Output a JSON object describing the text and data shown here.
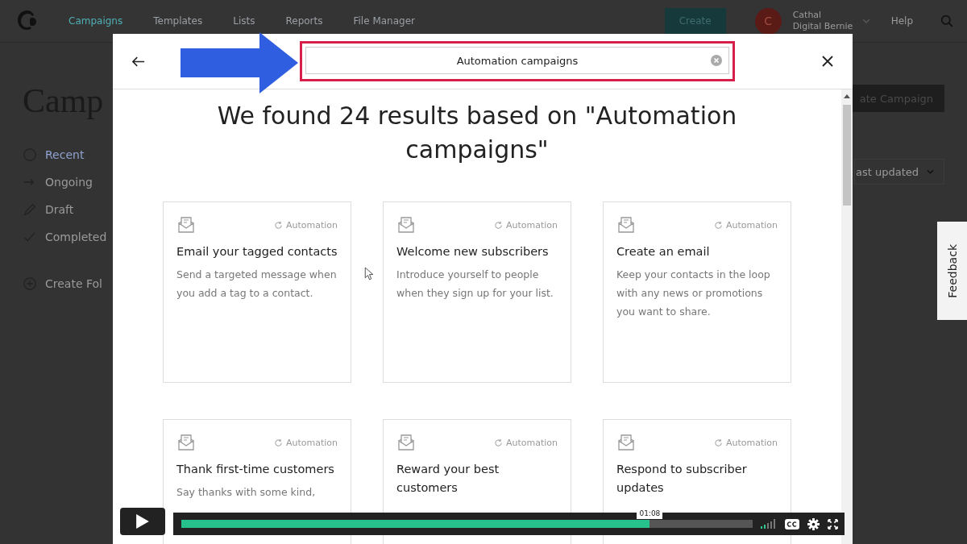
{
  "app_nav": {
    "items": [
      {
        "label": "Campaigns",
        "selected": true
      },
      {
        "label": "Templates",
        "selected": false
      },
      {
        "label": "Lists",
        "selected": false
      },
      {
        "label": "Reports",
        "selected": false
      },
      {
        "label": "File Manager",
        "selected": false
      }
    ],
    "create_button": "Create",
    "avatar_initial": "C",
    "account_name": "Cathal",
    "account_subtitle": "Digital Bernie",
    "help": "Help"
  },
  "page": {
    "title": "Camp",
    "sidebar": [
      {
        "label": "Recent",
        "selected": true
      },
      {
        "label": "Ongoing",
        "selected": false
      },
      {
        "label": "Draft",
        "selected": false
      },
      {
        "label": "Completed",
        "selected": false
      }
    ],
    "create_folder": "Create Fol",
    "create_campaign_button": "ate Campaign",
    "sort_select": "ast updated"
  },
  "modal": {
    "search_value": "Automation campaigns",
    "heading": "We found 24 results based on \"Automation campaigns\"",
    "cards": [
      {
        "tag": "Automation",
        "title": "Email your tagged contacts",
        "description": "Send a targeted message when you add a tag to a contact."
      },
      {
        "tag": "Automation",
        "title": "Welcome new subscribers",
        "description": "Introduce yourself to people when they sign up for your list."
      },
      {
        "tag": "Automation",
        "title": "Create an email",
        "description": "Keep your contacts in the loop with any news or promotions you want to share."
      },
      {
        "tag": "Automation",
        "title": "Thank first-time customers",
        "description": "Say thanks with some kind,"
      },
      {
        "tag": "Automation",
        "title": "Reward your best customers"
      },
      {
        "tag": "Automation",
        "title": "Respond to subscriber updates"
      }
    ]
  },
  "feedback_tab": "Feedback",
  "video": {
    "level": 0.82,
    "time": "01:08"
  }
}
